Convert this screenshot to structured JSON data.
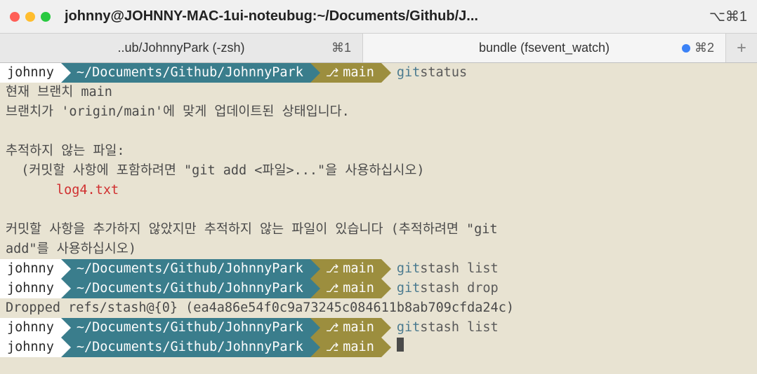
{
  "titlebar": {
    "title": "johnny@JOHNNY-MAC-1ui-noteubug:~/Documents/Github/J...",
    "shortcut": "⌥⌘1"
  },
  "tabs": [
    {
      "label": "..ub/JohnnyPark (-zsh)",
      "shortcut": "⌘1",
      "active": false,
      "indicator": false
    },
    {
      "label": "bundle (fsevent_watch)",
      "shortcut": "⌘2",
      "active": true,
      "indicator": true
    }
  ],
  "prompt": {
    "user": "johnny",
    "path": "~/Documents/Github/JohnnyPark",
    "branch": "main"
  },
  "output": {
    "status_cmd": "git",
    "status_args": " status",
    "l1": "현재 브랜치 main",
    "l2": "브랜치가 'origin/main'에 맞게 업데이트된 상태입니다.",
    "l3": "추적하지 않는 파일:",
    "l4": "  (커밋할 사항에 포함하려면 \"git add <파일>...\"을 사용하십시오)",
    "untracked": "log4.txt",
    "l5": "커밋할 사항을 추가하지 않았지만 추적하지 않는 파일이 있습니다 (추적하려면 \"git",
    "l6": "add\"를 사용하십시오)",
    "stash_list_cmd": "git",
    "stash_list_args": " stash list",
    "stash_drop_cmd": "git",
    "stash_drop_args": " stash drop",
    "dropped": "Dropped refs/stash@{0} (ea4a86e54f0c9a73245c084611b8ab709cfda24c)"
  }
}
